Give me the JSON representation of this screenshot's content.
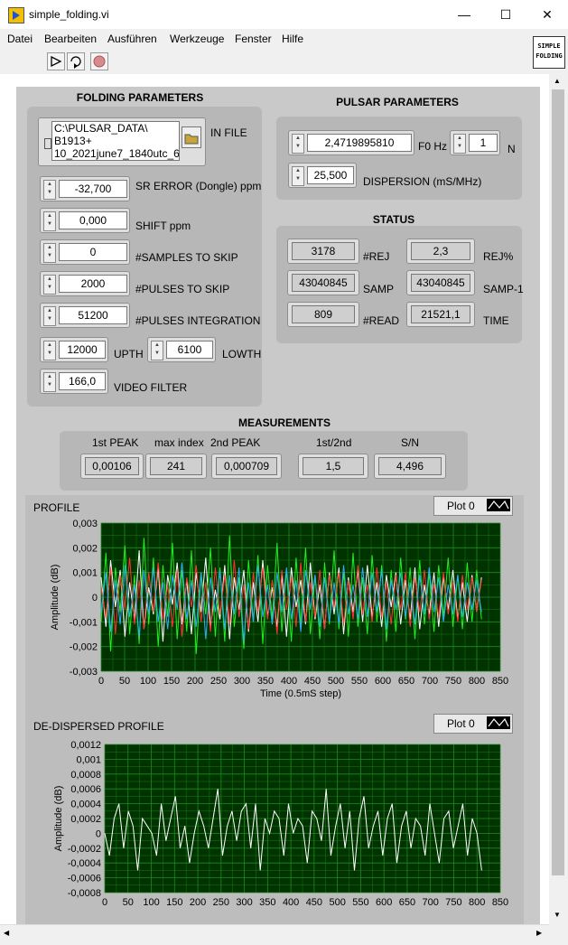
{
  "window": {
    "title": "simple_folding.vi",
    "minimize": "—",
    "maximize": "☐",
    "close": "✕"
  },
  "menu": [
    "Datei",
    "Bearbeiten",
    "Ausführen",
    "Werkzeuge",
    "Fenster",
    "Hilfe"
  ],
  "logo": {
    "line1": "SIMPLE",
    "line2": "FOLDING"
  },
  "folding": {
    "title": "FOLDING PARAMETERS",
    "in_file_label": "IN FILE",
    "in_file_lines": [
      "C:\\PULSAR_DATA\\",
      "B1913+",
      "10_2021june7_1840utc_6"
    ],
    "sr_error_label": "SR ERROR (Dongle) ppm",
    "sr_error": "-32,700",
    "shift_label": "SHIFT ppm",
    "shift": "0,000",
    "samples_skip_label": "#SAMPLES TO SKIP",
    "samples_skip": "0",
    "pulses_skip_label": "#PULSES TO SKIP",
    "pulses_skip": "2000",
    "pulses_int_label": "#PULSES INTEGRATION",
    "pulses_int": "51200",
    "upth_label": "UPTH",
    "upth": "12000",
    "lowth_label": "LOWTH",
    "lowth": "6100",
    "video_label": "VIDEO FILTER",
    "video": "166,0"
  },
  "pulsar": {
    "title": "PULSAR PARAMETERS",
    "f0_label": "F0 Hz",
    "f0": "2,4719895810",
    "n_label": "N",
    "n": "1",
    "dm_label": "DISPERSION (mS/MHz)",
    "dm": "25,500"
  },
  "status": {
    "title": "STATUS",
    "rej_label": "#REJ",
    "rej": "3178",
    "rejpct_label": "REJ%",
    "rejpct": "2,3",
    "samp_label": "SAMP",
    "samp": "43040845",
    "samp1_label": "SAMP-1",
    "samp1": "43040845",
    "read_label": "#READ",
    "read": "809",
    "time_label": "TIME",
    "time": "21521,1"
  },
  "measurements": {
    "title": "MEASUREMENTS",
    "peak1_label": "1st PEAK",
    "peak1": "0,00106",
    "maxidx_label": "max index",
    "maxidx": "241",
    "peak2_label": "2nd PEAK",
    "peak2": "0,000709",
    "ratio_label": "1st/2nd",
    "ratio": "1,5",
    "sn_label": "S/N",
    "sn": "4,496"
  },
  "profile": {
    "title": "PROFILE",
    "plot_label": "Plot 0"
  },
  "dedispersed": {
    "title": "DE-DISPERSED PROFILE",
    "plot_label": "Plot 0"
  },
  "colors": {
    "plot_bg": "#003300",
    "grid": "#1f8a1f",
    "trace": "#ffffff"
  },
  "chart_data": [
    {
      "type": "line",
      "title": "PROFILE",
      "xlabel": "Time (0.5mS step)",
      "ylabel": "Amplitude (dB)",
      "xlim": [
        0,
        850
      ],
      "ylim": [
        -0.003,
        0.003
      ],
      "x_ticks": [
        "0",
        "50",
        "100",
        "150",
        "200",
        "250",
        "300",
        "350",
        "400",
        "450",
        "500",
        "550",
        "600",
        "650",
        "700",
        "750",
        "800",
        "850"
      ],
      "y_ticks": [
        "0,003",
        "0,002",
        "0,001",
        "0",
        "-0,001",
        "-0,002",
        "-0,003"
      ],
      "grid": true,
      "series": [
        {
          "color": "#ffffff",
          "values": [
            0.0008,
            -0.0012,
            0.0015,
            -0.0004,
            0.0011,
            -0.0016,
            0.0006,
            -0.0009,
            0.0019,
            -0.0013,
            0.0004,
            -0.0007,
            0.0012,
            -0.0018,
            0.0009,
            -0.0003,
            0.0014,
            -0.0011,
            0.0007,
            -0.0015,
            0.001,
            -0.0006,
            0.0016,
            -0.0012,
            0.0003,
            -0.0009,
            0.0013,
            -0.0017,
            0.0008,
            -0.0005,
            0.0011,
            -0.0014,
            0.0006,
            -0.001,
            0.0015,
            -0.0008,
            0.0004,
            -0.0012,
            0.0009,
            -0.0016,
            0.0012,
            -0.0004,
            0.0007,
            -0.0011,
            0.0014,
            -0.0009,
            0.0005,
            -0.0013,
            0.001,
            -0.0007,
            0.0012,
            -0.0015,
            0.0008,
            -0.0006,
            0.0011,
            -0.001,
            0.0013,
            -0.0008,
            0.0006,
            -0.0012,
            0.0009,
            -0.0004,
            0.001,
            -0.0011,
            0.0007,
            -0.0009,
            0.0012,
            -0.0013,
            0.0005,
            -0.0007,
            0.001,
            -0.0012,
            0.0008,
            -0.0005,
            0.0011,
            -0.0009,
            0.0006,
            -0.001,
            0.0009,
            -0.0006,
            0.0008
          ]
        },
        {
          "color": "#22ee22",
          "values": [
            -0.001,
            0.0018,
            -0.0022,
            0.0012,
            -0.0006,
            0.0021,
            -0.0015,
            0.0009,
            -0.0019,
            0.0024,
            -0.0011,
            0.0016,
            -0.002,
            0.0013,
            -0.0008,
            0.0022,
            -0.0017,
            0.0011,
            -0.0014,
            0.0019,
            -0.0023,
            0.001,
            -0.0007,
            0.002,
            -0.0016,
            0.0012,
            -0.0018,
            0.0025,
            -0.0012,
            0.0008,
            -0.0021,
            0.0015,
            -0.001,
            0.0017,
            -0.0019,
            0.0013,
            -0.0009,
            0.0022,
            -0.0014,
            0.0011,
            -0.0018,
            0.0016,
            -0.0012,
            0.002,
            -0.0015,
            0.0009,
            -0.0017,
            0.0014,
            -0.0011,
            0.0019,
            -0.0013,
            0.001,
            -0.0016,
            0.0018,
            -0.0012,
            0.0008,
            -0.0015,
            0.0017,
            -0.001,
            0.0013,
            -0.0018,
            0.0011,
            -0.0014,
            0.0016,
            -0.0009,
            0.0012,
            -0.0017,
            0.0015,
            -0.0011,
            0.001,
            -0.0014,
            0.0013,
            -0.0008,
            0.0016,
            -0.0012,
            0.0009,
            -0.0013,
            0.0014,
            -0.001,
            0.0011,
            -0.0009
          ]
        },
        {
          "color": "#ff3333",
          "values": [
            0.0004,
            -0.0008,
            0.0012,
            -0.0015,
            0.0009,
            -0.0005,
            0.0016,
            -0.0011,
            0.0007,
            -0.0013,
            0.001,
            -0.0006,
            0.0014,
            -0.0009,
            0.0005,
            -0.0012,
            0.0011,
            -0.0016,
            0.0008,
            -0.0004,
            0.0013,
            -0.001,
            0.0006,
            -0.0014,
            0.0012,
            -0.0007,
            0.0009,
            -0.0011,
            0.0015,
            -0.0008,
            0.0005,
            -0.0013,
            0.001,
            -0.0006,
            0.0012,
            -0.0009,
            0.0007,
            -0.0015,
            0.0011,
            -0.0005,
            0.0008,
            -0.0012,
            0.0014,
            -0.001,
            0.0006,
            -0.0008,
            0.0011,
            -0.0013,
            0.0009,
            -0.0004,
            0.001,
            -0.0011,
            0.0007,
            -0.0009,
            0.0013,
            -0.0007,
            0.0005,
            -0.001,
            0.0012,
            -0.0008,
            0.0006,
            -0.0011,
            0.0009,
            -0.0005,
            0.001,
            -0.0012,
            0.0008,
            -0.0006,
            0.0011,
            -0.0009,
            0.0005,
            -0.0008,
            0.001,
            -0.0007,
            0.0006,
            -0.001,
            0.0009,
            -0.0005,
            0.0008,
            -0.0006,
            0.0007
          ]
        },
        {
          "color": "#33aaff",
          "values": [
            -0.0006,
            0.001,
            -0.0014,
            0.0007,
            -0.0011,
            0.0013,
            -0.0008,
            0.0005,
            -0.0016,
            0.0011,
            -0.0007,
            0.0012,
            -0.001,
            0.0006,
            -0.0013,
            0.0009,
            -0.0005,
            0.0014,
            -0.0009,
            0.0007,
            -0.0012,
            0.001,
            -0.0017,
            0.0008,
            -0.0006,
            0.0011,
            -0.0013,
            0.0009,
            -0.0007,
            0.0012,
            -0.0018,
            0.0006,
            -0.001,
            0.0013,
            -0.0008,
            0.0005,
            -0.0011,
            0.001,
            -0.0006,
            0.0012,
            -0.0009,
            0.0007,
            -0.0014,
            0.0011,
            -0.0005,
            0.0009,
            -0.0012,
            0.0008,
            -0.001,
            0.0006,
            -0.0011,
            0.0013,
            -0.0007,
            0.0005,
            -0.0009,
            0.0012,
            -0.0008,
            0.001,
            -0.0006,
            0.0011,
            -0.0013,
            0.0007,
            -0.0005,
            0.001,
            -0.0008,
            0.0006,
            -0.0011,
            0.0009,
            -0.0007,
            0.0012,
            -0.0006,
            0.0008,
            -0.001,
            0.0005,
            -0.0007,
            0.0009,
            -0.0008,
            0.0006,
            -0.0005,
            0.0007,
            -0.0006
          ]
        }
      ]
    },
    {
      "type": "line",
      "title": "DE-DISPERSED PROFILE",
      "xlabel": "",
      "ylabel": "Amplitude (dB)",
      "xlim": [
        0,
        850
      ],
      "ylim": [
        -0.0008,
        0.0012
      ],
      "x_ticks": [
        "0",
        "50",
        "100",
        "150",
        "200",
        "250",
        "300",
        "350",
        "400",
        "450",
        "500",
        "550",
        "600",
        "650",
        "700",
        "750",
        "800",
        "850"
      ],
      "y_ticks": [
        "0,0012",
        "0,001",
        "0,0008",
        "0,0006",
        "0,0004",
        "0,0002",
        "0",
        "-0,0002",
        "-0,0004",
        "-0,0006",
        "-0,0008"
      ],
      "grid": true,
      "series": [
        {
          "color": "#ffffff",
          "values": [
            0.0,
            -0.0003,
            0.0002,
            0.0004,
            -0.0002,
            0.0003,
            0.0001,
            -0.0005,
            0.0002,
            0.0001,
            0.0,
            -0.0003,
            0.0004,
            -0.0001,
            0.0002,
            0.0005,
            -0.0002,
            0.0001,
            -0.0004,
            0.0,
            0.0003,
            0.0001,
            -0.0002,
            0.0002,
            0.0006,
            -0.0003,
            0.0001,
            0.0003,
            -0.0001,
            0.0003,
            0.0004,
            -0.0002,
            0.0004,
            -0.0005,
            0.0002,
            0.0,
            0.0003,
            0.0002,
            -0.0003,
            0.0004,
            0.0,
            0.0002,
            0.0001,
            -0.0004,
            0.0003,
            0.0002,
            -0.0001,
            0.0006,
            -0.0003,
            0.0001,
            0.0004,
            -0.0002,
            0.0003,
            -0.0005,
            0.0002,
            0.0005,
            -0.0002,
            0.0001,
            0.0003,
            -0.0003,
            0.0002,
            0.0004,
            -0.0004,
            0.0001,
            0.0003,
            -0.0002,
            0.0002,
            0.0001,
            -0.0003,
            0.0004,
            0.0,
            -0.0004,
            0.0002,
            0.0003,
            -0.0002,
            0.0001,
            0.0004,
            -0.0003,
            0.0002,
            0.0,
            -0.0005
          ]
        }
      ]
    }
  ]
}
